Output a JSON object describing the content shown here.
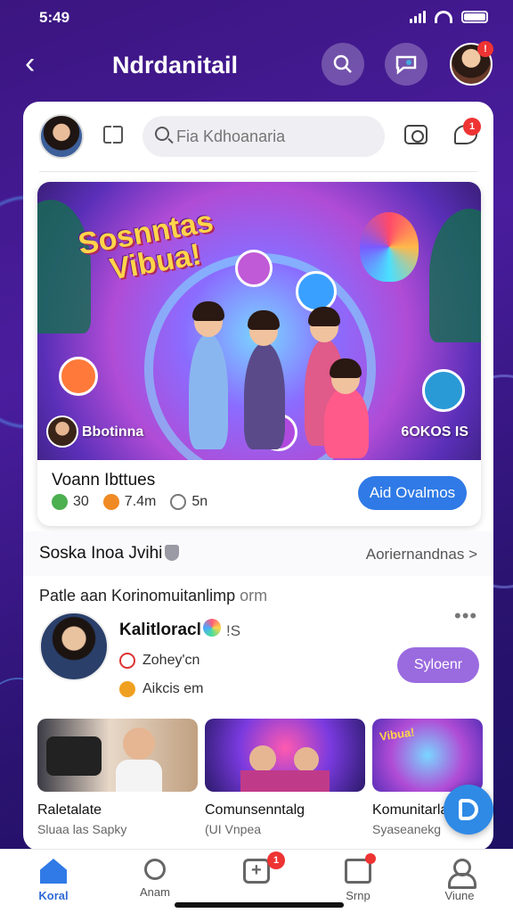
{
  "status": {
    "time": "5:49"
  },
  "header": {
    "title": "Ndrdanitail",
    "badge": "!"
  },
  "search": {
    "placeholder": "Fia Kdhoanaria"
  },
  "notifications": {
    "count": "1"
  },
  "featured": {
    "banner_title_line1": "Sosnntas",
    "banner_title_line2": "Vibua!",
    "banner_left_label": "Bbotinna",
    "banner_right_label": "6OKOS IS",
    "name": "Voann Ibttues",
    "stats": [
      {
        "icon": "leaf-icon",
        "value": "30",
        "color": "#4caf50"
      },
      {
        "icon": "fire-icon",
        "value": "7.4m",
        "color": "#f08a24"
      },
      {
        "icon": "clock-icon",
        "value": "5n",
        "color": "#777777"
      }
    ],
    "join_button": "Aid Ovalmos"
  },
  "section": {
    "title": "Soska Inoa Jvihi",
    "link": "Aoriernandnas >"
  },
  "post": {
    "title": "Patle aan Korinomuitanlimp",
    "title_suffix": "orm",
    "author": "Kalitloracl",
    "author_suffix": "!S",
    "line1": "Zohey'cn",
    "line2": "Aikcis em",
    "subscribe_button": "Syloenr"
  },
  "thumbs": [
    {
      "title": "Raletalate",
      "subtitle": "Sluaa las Sapky"
    },
    {
      "title": "Comunsenntalg",
      "subtitle": "(UI Vnpea"
    },
    {
      "title": "Komunitarlai",
      "subtitle": "Syaseanekg"
    }
  ],
  "nav": [
    {
      "label": "Koral",
      "active": true
    },
    {
      "label": "Anam"
    },
    {
      "label": "",
      "badge": "1"
    },
    {
      "label": "Srnp"
    },
    {
      "label": "Viune"
    }
  ],
  "colors": {
    "accent": "#2f7ae6",
    "brand_bg": "#3b1580",
    "badge": "#e33333",
    "subscribe": "#9a6adf"
  }
}
